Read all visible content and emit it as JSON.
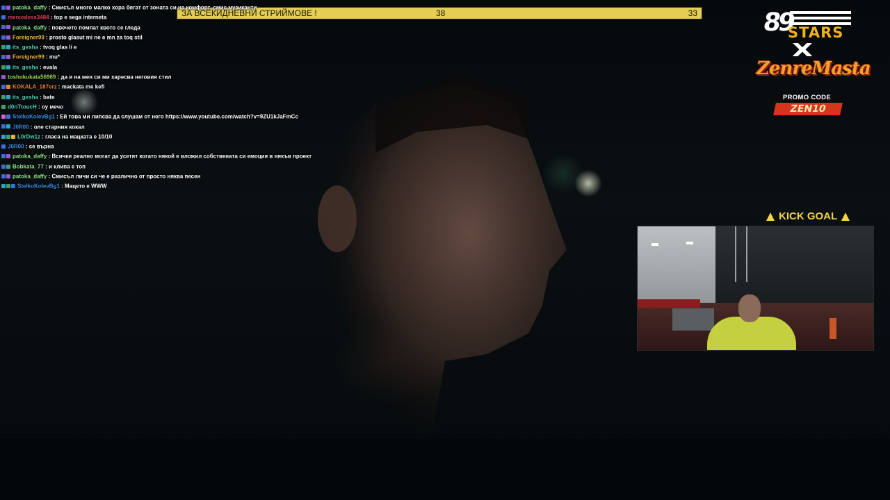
{
  "goal": {
    "label": "ЗА ВСЕКИДНЕВНИ СТРИЙМОВЕ !",
    "current": "38",
    "target": "33",
    "progress_fraction": 1.0,
    "bar_color": "#d3be47"
  },
  "chat": {
    "messages": [
      {
        "user": "patoka_daffy",
        "color": "#8fe388",
        "badges": [
          "#3b6fd6",
          "#9b59d0"
        ],
        "text": "Смисъл много малко хора бягат от зоната си на комфорт, смис музиканти"
      },
      {
        "user": "mercedess3484",
        "color": "#e0415a",
        "badges": [
          "#3b6fd6"
        ],
        "text": "top e sega interneta"
      },
      {
        "user": "patoka_daffy",
        "color": "#8fe388",
        "badges": [
          "#3b6fd6",
          "#9b59d0"
        ],
        "text": "повечето помпат квото се гледа"
      },
      {
        "user": "Foreigner99",
        "color": "#e8b33d",
        "badges": [
          "#3b6fd6",
          "#9b59d0"
        ],
        "text": "prosto glasut mi ne e mn za toq stil"
      },
      {
        "user": "its_gesha",
        "color": "#4dd4b0",
        "badges": [
          "#3fa06b",
          "#2ea3c8"
        ],
        "text": "tvoq glas li e"
      },
      {
        "user": "Foreigner99",
        "color": "#e8b33d",
        "badges": [
          "#3b6fd6",
          "#9b59d0"
        ],
        "text": "mu*"
      },
      {
        "user": "its_gesha",
        "color": "#4dd4b0",
        "badges": [
          "#3fa06b",
          "#2ea3c8"
        ],
        "text": "evala"
      },
      {
        "user": "toshokukata56969",
        "color": "#9bd84a",
        "badges": [
          "#9b59d0"
        ],
        "text": "да и на мен си ми харесва неговия стил"
      },
      {
        "user": "KOKALA_187erz",
        "color": "#e6812e",
        "badges": [
          "#3b6fd6",
          "#e6812e"
        ],
        "text": "mackata me kefi"
      },
      {
        "user": "its_gesha",
        "color": "#4dd4b0",
        "badges": [
          "#3fa06b",
          "#2ea3c8"
        ],
        "text": "bate"
      },
      {
        "user": "d0nTtoucH",
        "color": "#4dd4b0",
        "badges": [
          "#3fa06b"
        ],
        "text": "оу мечо"
      },
      {
        "user": "StelkoKolevBg1",
        "color": "#3f8ee0",
        "badges": [
          "#d35fd3",
          "#3b6fd6"
        ],
        "text": "Ей това ми липсва да слушам от него https://www.youtube.com/watch?v=9ZU1kJaFmCc"
      },
      {
        "user": "J0R00",
        "color": "#3f8ee0",
        "badges": [
          "#3b6fd6",
          "#2ea3c8"
        ],
        "text": "оле старния кокал"
      },
      {
        "user": "L0rDw1z",
        "color": "#4dd4b0",
        "badges": [
          "#2ea3c8",
          "#3fa06b",
          "#e6b52e"
        ],
        "text": "гласа на мацката е 10/10"
      },
      {
        "user": "J0R00",
        "color": "#3f8ee0",
        "badges": [
          "#3b6fd6"
        ],
        "text": "се върна"
      },
      {
        "user": "patoka_daffy",
        "color": "#8fe388",
        "badges": [
          "#3b6fd6",
          "#9b59d0"
        ],
        "text": "Всички реално могат да усетят когато някой е вложил собствената си емоция в някъв проект"
      },
      {
        "user": "Bobkata_77",
        "color": "#8fe388",
        "badges": [
          "#3b6fd6",
          "#3fa06b"
        ],
        "text": "и клипа е топ"
      },
      {
        "user": "patoka_daffy",
        "color": "#8fe388",
        "badges": [
          "#3b6fd6",
          "#9b59d0"
        ],
        "text": "Смисъл личи си че е различно от просто няква песен"
      },
      {
        "user": "StelkoKolevBg1",
        "color": "#3f8ee0",
        "badges": [
          "#2ea3c8",
          "#3fa06b",
          "#3b6fd6"
        ],
        "text": "Мацето е WWW"
      }
    ]
  },
  "brand": {
    "number": "89",
    "stars": "STARS",
    "x": "X",
    "sponsor": "ZenreMasta",
    "promo_label": "PROMO CODE",
    "promo_code": "ZEN10"
  },
  "kick_goal": {
    "label": "KICK GOAL",
    "left_icon": "arrow-up-icon",
    "right_icon": "arrow-up-icon",
    "color": "#f4d34a"
  }
}
